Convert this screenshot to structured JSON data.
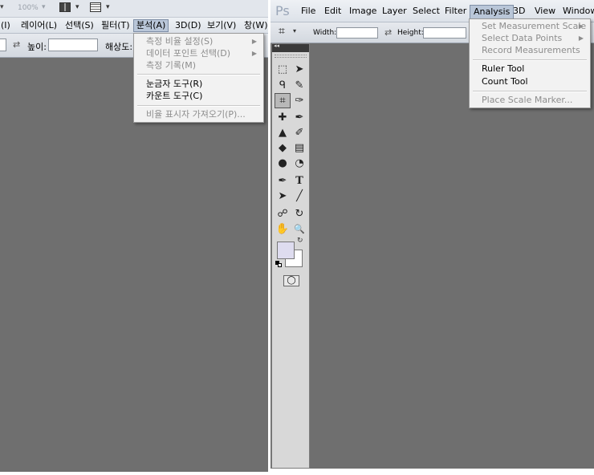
{
  "korean": {
    "toolbar": {
      "zoom_value": "100%",
      "dropdown_arrow": "▾"
    },
    "menu": [
      {
        "label": "(I)"
      },
      {
        "label": "레이어(L)"
      },
      {
        "label": "선택(S)"
      },
      {
        "label": "필터(T)"
      },
      {
        "label": "분석(A)"
      },
      {
        "label": "3D(D)"
      },
      {
        "label": "보기(V)"
      },
      {
        "label": "창(W)"
      }
    ],
    "options": {
      "swap_glyph": "⇄",
      "height_label": "높이:",
      "resolution_label": "해상도:"
    },
    "analysis_menu": {
      "set_scale": "측정 비율 설정(S)",
      "data_points": "데이터 포인트 선택(D)",
      "record": "측정 기록(M)",
      "ruler": "눈금자 도구(R)",
      "count": "카운트 도구(C)",
      "place_scale": "비율 표시자 가져오기(P)..."
    }
  },
  "english": {
    "ps_logo": "Ps",
    "menu": [
      {
        "label": "File"
      },
      {
        "label": "Edit"
      },
      {
        "label": "Image"
      },
      {
        "label": "Layer"
      },
      {
        "label": "Select"
      },
      {
        "label": "Filter"
      },
      {
        "label": "Analysis"
      },
      {
        "label": "3D"
      },
      {
        "label": "View"
      },
      {
        "label": "Window"
      }
    ],
    "options": {
      "crop_icon": "crop-icon",
      "width_label": "Width:",
      "swap_glyph": "⇄",
      "height_label": "Height:"
    },
    "analysis_menu": {
      "set_scale": "Set Measurement Scale",
      "data_points": "Select Data Points",
      "record": "Record Measurements",
      "ruler": "Ruler Tool",
      "count": "Count Tool",
      "place_scale": "Place Scale Marker..."
    },
    "toolbox": {
      "collapse_glyph": "◂◂",
      "tools": [
        {
          "icon": "marquee-icon",
          "glyph": "⬚"
        },
        {
          "icon": "move-icon",
          "glyph": "➤"
        },
        {
          "icon": "lasso-icon",
          "glyph": "ᑫ"
        },
        {
          "icon": "quick-select-icon",
          "glyph": "✎"
        },
        {
          "icon": "crop-icon",
          "glyph": "⌗"
        },
        {
          "icon": "eyedropper-icon",
          "glyph": "✑"
        },
        {
          "icon": "healing-brush-icon",
          "glyph": "✚"
        },
        {
          "icon": "brush-icon",
          "glyph": "✒"
        },
        {
          "icon": "clone-stamp-icon",
          "glyph": "▲"
        },
        {
          "icon": "history-brush-icon",
          "glyph": "✐"
        },
        {
          "icon": "eraser-icon",
          "glyph": "◆"
        },
        {
          "icon": "gradient-icon",
          "glyph": "▤"
        },
        {
          "icon": "blur-icon",
          "glyph": "●"
        },
        {
          "icon": "dodge-icon",
          "glyph": "◔"
        },
        {
          "icon": "pen-icon",
          "glyph": "✒"
        },
        {
          "icon": "type-icon",
          "glyph": "T"
        },
        {
          "icon": "path-select-icon",
          "glyph": "➤"
        },
        {
          "icon": "line-icon",
          "glyph": "╱"
        },
        {
          "icon": "3d-rotate-icon",
          "glyph": "☍"
        },
        {
          "icon": "3d-orbit-icon",
          "glyph": "↻"
        },
        {
          "icon": "hand-icon",
          "glyph": "✋"
        },
        {
          "icon": "zoom-icon",
          "glyph": "🔍"
        }
      ],
      "quick_mask_glyph": "◯",
      "foreground_color": "#dedcef",
      "background_color": "#ffffff"
    }
  },
  "colors": {
    "canvas": "#6f6f6f",
    "menu_active": "#b9c6d8",
    "toolbox": "#d8d8d8"
  }
}
